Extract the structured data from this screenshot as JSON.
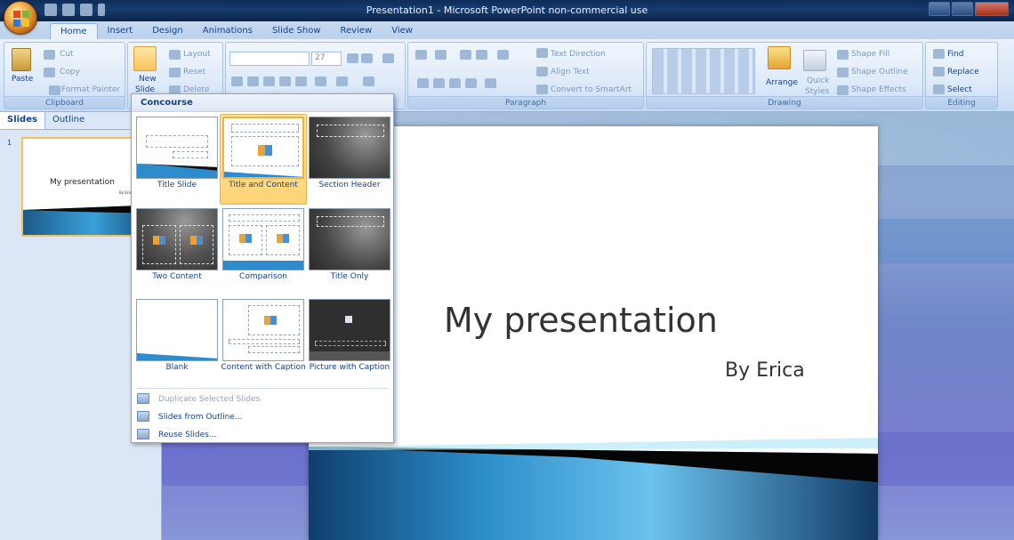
{
  "window": {
    "title": "Presentation1 - Microsoft PowerPoint non-commercial use"
  },
  "tabs": [
    {
      "label": "Home",
      "active": true
    },
    {
      "label": "Insert"
    },
    {
      "label": "Design"
    },
    {
      "label": "Animations"
    },
    {
      "label": "Slide Show"
    },
    {
      "label": "Review"
    },
    {
      "label": "View"
    }
  ],
  "ribbon": {
    "clipboard": {
      "label": "Clipboard",
      "paste": "Paste",
      "cut": "Cut",
      "copy": "Copy",
      "format_painter": "Format Painter"
    },
    "slides": {
      "new_slide_line1": "New",
      "new_slide_line2": "Slide",
      "layout": "Layout",
      "reset": "Reset",
      "delete": "Delete"
    },
    "font": {
      "size_value": "27"
    },
    "paragraph": {
      "label": "Paragraph",
      "text_direction": "Text Direction",
      "align_text": "Align Text",
      "convert_smartart": "Convert to SmartArt"
    },
    "drawing": {
      "label": "Drawing",
      "arrange": "Arrange",
      "quick_styles_1": "Quick",
      "quick_styles_2": "Styles",
      "shape_fill": "Shape Fill",
      "shape_outline": "Shape Outline",
      "shape_effects": "Shape Effects"
    },
    "editing": {
      "label": "Editing",
      "find": "Find",
      "replace": "Replace",
      "select": "Select"
    }
  },
  "left_pane": {
    "tabs": [
      {
        "label": "Slides",
        "active": true
      },
      {
        "label": "Outline"
      }
    ],
    "thumb_number": "1",
    "thumb_title": "My presentation",
    "thumb_sub": "By Erica"
  },
  "slide": {
    "title": "My presentation",
    "subtitle": "By Erica"
  },
  "new_slide_menu": {
    "header": "Concourse",
    "layouts": [
      {
        "label": "Title Slide"
      },
      {
        "label": "Title and Content",
        "selected": true
      },
      {
        "label": "Section Header"
      },
      {
        "label": "Two Content"
      },
      {
        "label": "Comparison"
      },
      {
        "label": "Title Only"
      },
      {
        "label": "Blank"
      },
      {
        "label": "Content with Caption"
      },
      {
        "label": "Picture with Caption"
      }
    ],
    "commands": [
      {
        "label": "Duplicate Selected Slides",
        "disabled": true
      },
      {
        "label": "Slides from Outline..."
      },
      {
        "label": "Reuse Slides..."
      }
    ]
  },
  "colors": {
    "accent": "#f2b23f",
    "ribbon_text": "#15428b",
    "title_bar": "#0d2c59"
  }
}
